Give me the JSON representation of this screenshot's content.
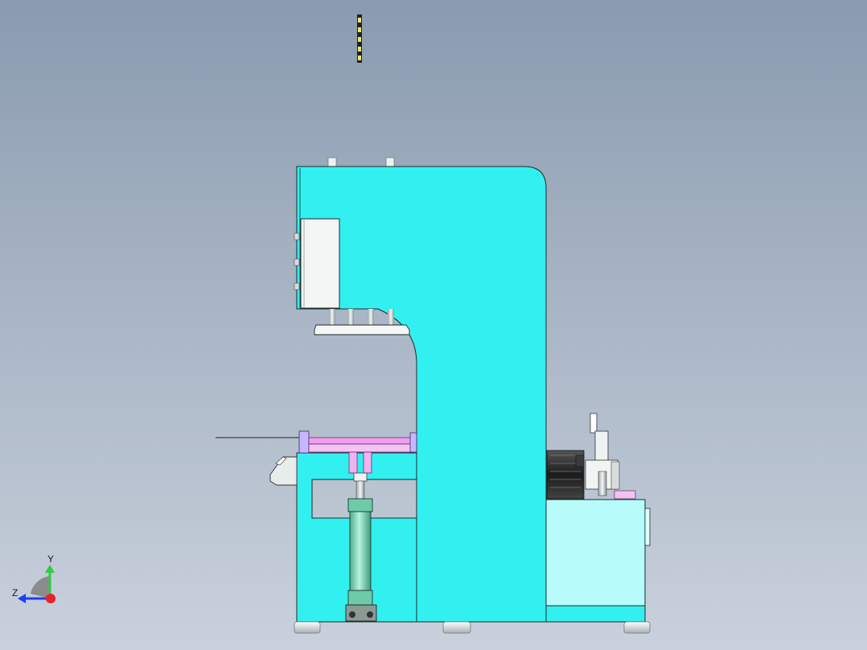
{
  "app": {
    "title": ""
  },
  "model": {
    "view": "side",
    "colors": {
      "background_top": "#8a9bb0",
      "background_bottom": "#c9d1dc",
      "frame": "#33f0f0",
      "frame_shade": "#1fc9c9",
      "hydraulic_tank": "#b8fbfb",
      "fixture": "#ee99ee",
      "cylinder": "#7ed8b8",
      "motor": "#2a2a2a",
      "edge": "#1b2a2a"
    },
    "icons": [
      "coordinate-triad-icon"
    ]
  },
  "triad": {
    "y_label": "Y",
    "z_label": "Z",
    "colors": {
      "y": "#2ecc40",
      "z": "#1f3cff",
      "origin": "#e8222b"
    }
  }
}
